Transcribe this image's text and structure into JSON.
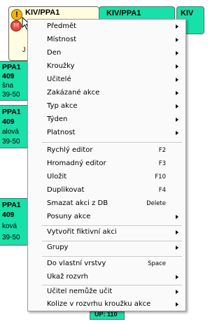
{
  "cells": {
    "c1_title": "KIV/PPA1",
    "c1_footer": "J",
    "c2_title": "KIV/PPA1",
    "c3_title": "KIV",
    "left_rows": [
      {
        "title": "PPA1",
        "room": "409",
        "name": "šna",
        "time": "39-50"
      },
      {
        "title": "PPA1",
        "room": "409",
        "name": "alová",
        "time": "39-50"
      },
      {
        "title": "PPA1",
        "room": "409",
        "name": "ková",
        "time": "39-50"
      }
    ],
    "right_bottom_partial": "UP: 110"
  },
  "icons": {
    "warning": "exclamation-icon",
    "warning_glyph": "!",
    "stop": "stop-icon",
    "stop_glyph": "!!!",
    "cursor": "mouse-pointer-icon"
  },
  "colors": {
    "yellow_cell": "#fffde0",
    "green_cell": "#17e0a8",
    "menu_bg": "#fafafa"
  },
  "menu": {
    "items": [
      {
        "label": "Předmět",
        "shortcut": "",
        "submenu": true
      },
      {
        "label": "Místnost",
        "shortcut": "",
        "submenu": true
      },
      {
        "label": "Den",
        "shortcut": "",
        "submenu": true
      },
      {
        "label": "Kroužky",
        "shortcut": "",
        "submenu": true
      },
      {
        "label": "Učitelé",
        "shortcut": "",
        "submenu": true
      },
      {
        "label": "Zakázané akce",
        "shortcut": "",
        "submenu": true
      },
      {
        "label": "Typ akce",
        "shortcut": "",
        "submenu": true
      },
      {
        "label": "Týden",
        "shortcut": "",
        "submenu": true
      },
      {
        "label": "Platnost",
        "shortcut": "",
        "submenu": true
      },
      {
        "label": "Rychlý editor",
        "shortcut": "F2",
        "submenu": false
      },
      {
        "label": "Hromadný editor",
        "shortcut": "F3",
        "submenu": false
      },
      {
        "label": "Uložit",
        "shortcut": "F10",
        "submenu": false
      },
      {
        "label": "Duplikovat",
        "shortcut": "F4",
        "submenu": false
      },
      {
        "label": "Smazat akci z DB",
        "shortcut": "Delete",
        "submenu": false
      },
      {
        "label": "Posuny akce",
        "shortcut": "",
        "submenu": true
      },
      {
        "label": "Vytvořit fiktivní akci",
        "shortcut": "",
        "submenu": true
      },
      {
        "label": "Grupy",
        "shortcut": "",
        "submenu": true
      },
      {
        "label": "Do vlastní vrstvy",
        "shortcut": "Space",
        "submenu": false
      },
      {
        "label": "Ukaž rozvrh",
        "shortcut": "",
        "submenu": true
      },
      {
        "label": "Učitel nemůže učit",
        "shortcut": "",
        "submenu": true
      },
      {
        "label": "Kolize v rozvrhu kroužku akce",
        "shortcut": "",
        "submenu": true
      }
    ]
  }
}
